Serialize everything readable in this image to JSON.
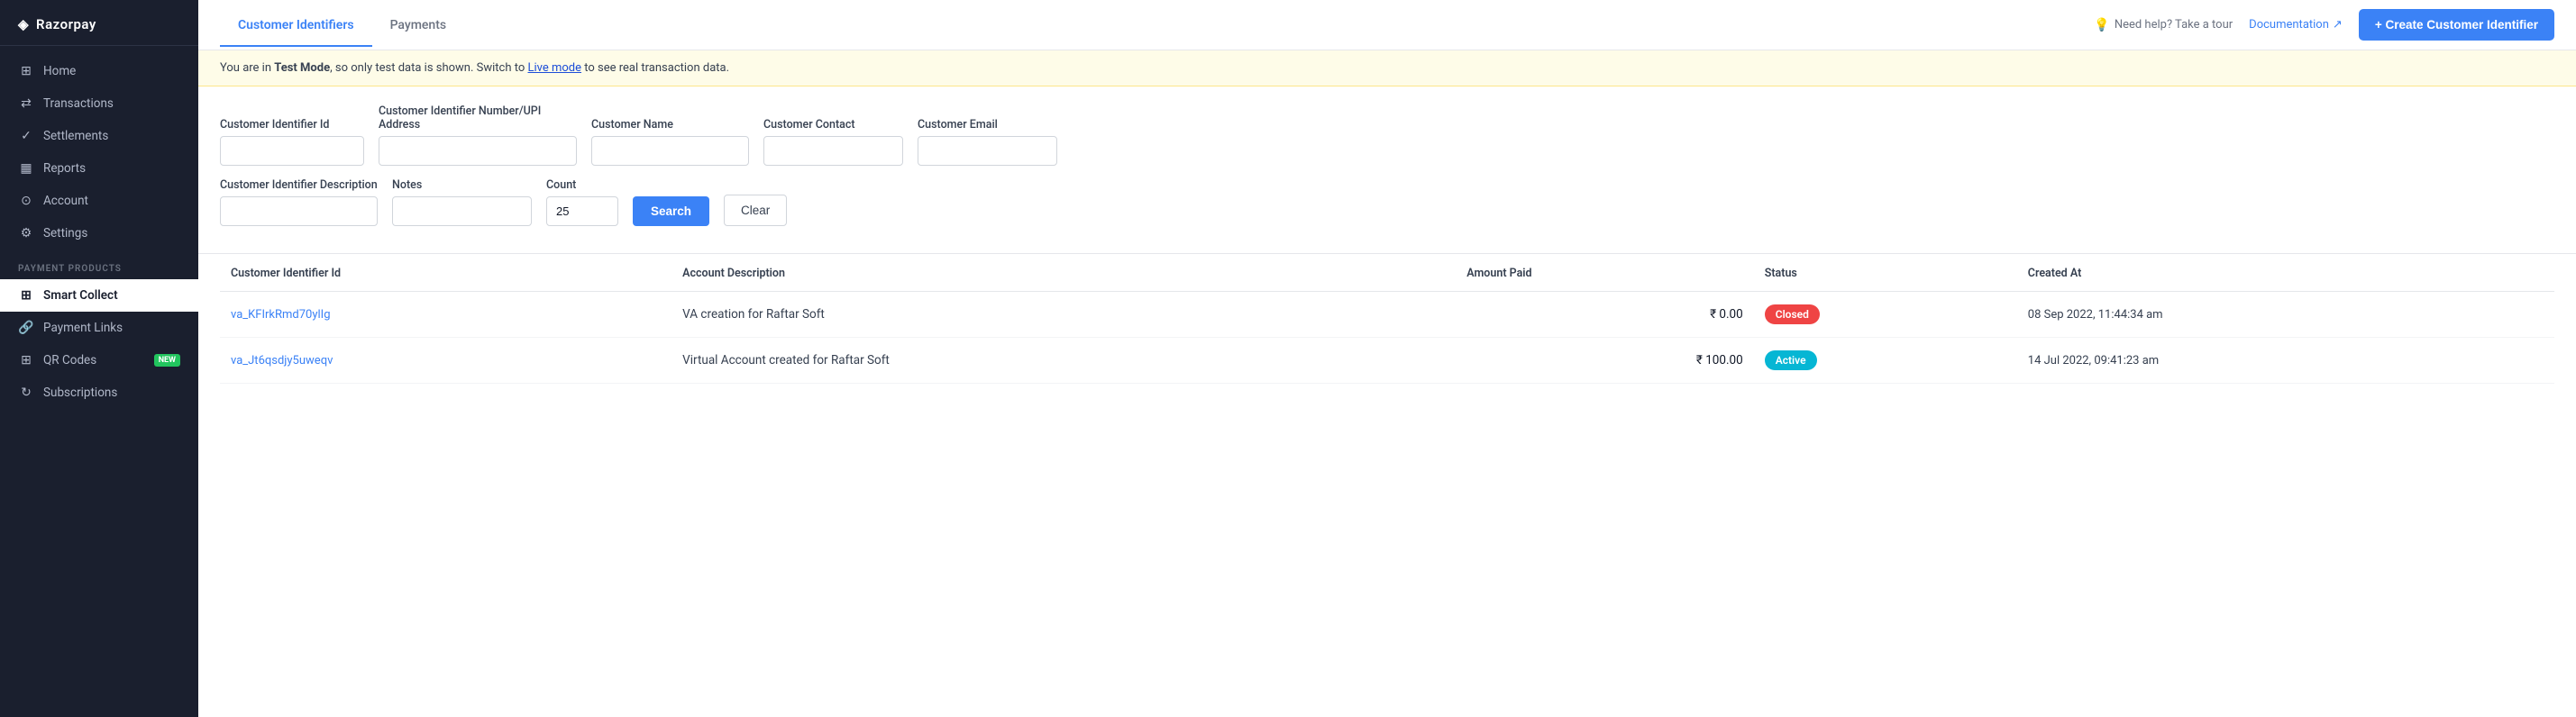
{
  "sidebar": {
    "logo": "Razorpay",
    "nav_items": [
      {
        "id": "home",
        "label": "Home",
        "icon": "⊞"
      },
      {
        "id": "transactions",
        "label": "Transactions",
        "icon": "⇄"
      },
      {
        "id": "settlements",
        "label": "Settlements",
        "icon": "✓"
      },
      {
        "id": "reports",
        "label": "Reports",
        "icon": "▦"
      },
      {
        "id": "account",
        "label": "Account",
        "icon": "⊙"
      },
      {
        "id": "settings",
        "label": "Settings",
        "icon": "⚙"
      }
    ],
    "payment_products_label": "PAYMENT PRODUCTS",
    "payment_products": [
      {
        "id": "smart-collect",
        "label": "Smart Collect",
        "icon": "⊞",
        "active": true
      },
      {
        "id": "payment-links",
        "label": "Payment Links",
        "icon": "🔗"
      },
      {
        "id": "qr-codes",
        "label": "QR Codes",
        "icon": "⊞",
        "badge": "NEW"
      },
      {
        "id": "subscriptions",
        "label": "Subscriptions",
        "icon": "↻"
      }
    ]
  },
  "header": {
    "tabs": [
      {
        "id": "customer-identifiers",
        "label": "Customer Identifiers",
        "active": true
      },
      {
        "id": "payments",
        "label": "Payments",
        "active": false
      }
    ],
    "help_link": "Need help? Take a tour",
    "doc_link": "Documentation",
    "create_button": "+ Create Customer Identifier"
  },
  "alert": {
    "text_before": "You are in ",
    "mode": "Test Mode",
    "text_mid": ", so only test data is shown. Switch to ",
    "link_text": "Live mode",
    "text_after": " to see real transaction data."
  },
  "filters": {
    "fields": [
      {
        "id": "customer-identifier-id",
        "label": "Customer Identifier Id",
        "placeholder": "",
        "size": "id"
      },
      {
        "id": "customer-identifier-number",
        "label": "Customer Identifier Number/UPI Address",
        "placeholder": "",
        "size": "upi"
      },
      {
        "id": "customer-name",
        "label": "Customer Name",
        "placeholder": "",
        "size": "name"
      },
      {
        "id": "customer-contact",
        "label": "Customer Contact",
        "placeholder": "",
        "size": "contact"
      },
      {
        "id": "customer-email",
        "label": "Customer Email",
        "placeholder": "",
        "size": "email"
      }
    ],
    "fields_row2": [
      {
        "id": "description",
        "label": "Customer Identifier Description",
        "placeholder": "",
        "size": "desc"
      },
      {
        "id": "notes",
        "label": "Notes",
        "placeholder": "",
        "size": "notes"
      },
      {
        "id": "count",
        "label": "Count",
        "value": "25",
        "size": "count"
      }
    ],
    "search_btn": "Search",
    "clear_btn": "Clear"
  },
  "table": {
    "columns": [
      {
        "id": "identifier-id",
        "label": "Customer Identifier Id"
      },
      {
        "id": "account-desc",
        "label": "Account Description"
      },
      {
        "id": "amount-paid",
        "label": "Amount Paid"
      },
      {
        "id": "status",
        "label": "Status"
      },
      {
        "id": "created-at",
        "label": "Created At"
      }
    ],
    "rows": [
      {
        "id": "va_KFIrkRmd70ylIg",
        "description": "VA creation for Raftar Soft",
        "amount": "₹ 0.00",
        "status": "Closed",
        "status_type": "closed",
        "created_at": "08 Sep 2022, 11:44:34 am"
      },
      {
        "id": "va_Jt6qsdjy5uweqv",
        "description": "Virtual Account created for Raftar Soft",
        "amount": "₹ 100.00",
        "status": "Active",
        "status_type": "active",
        "created_at": "14 Jul 2022, 09:41:23 am"
      }
    ]
  }
}
